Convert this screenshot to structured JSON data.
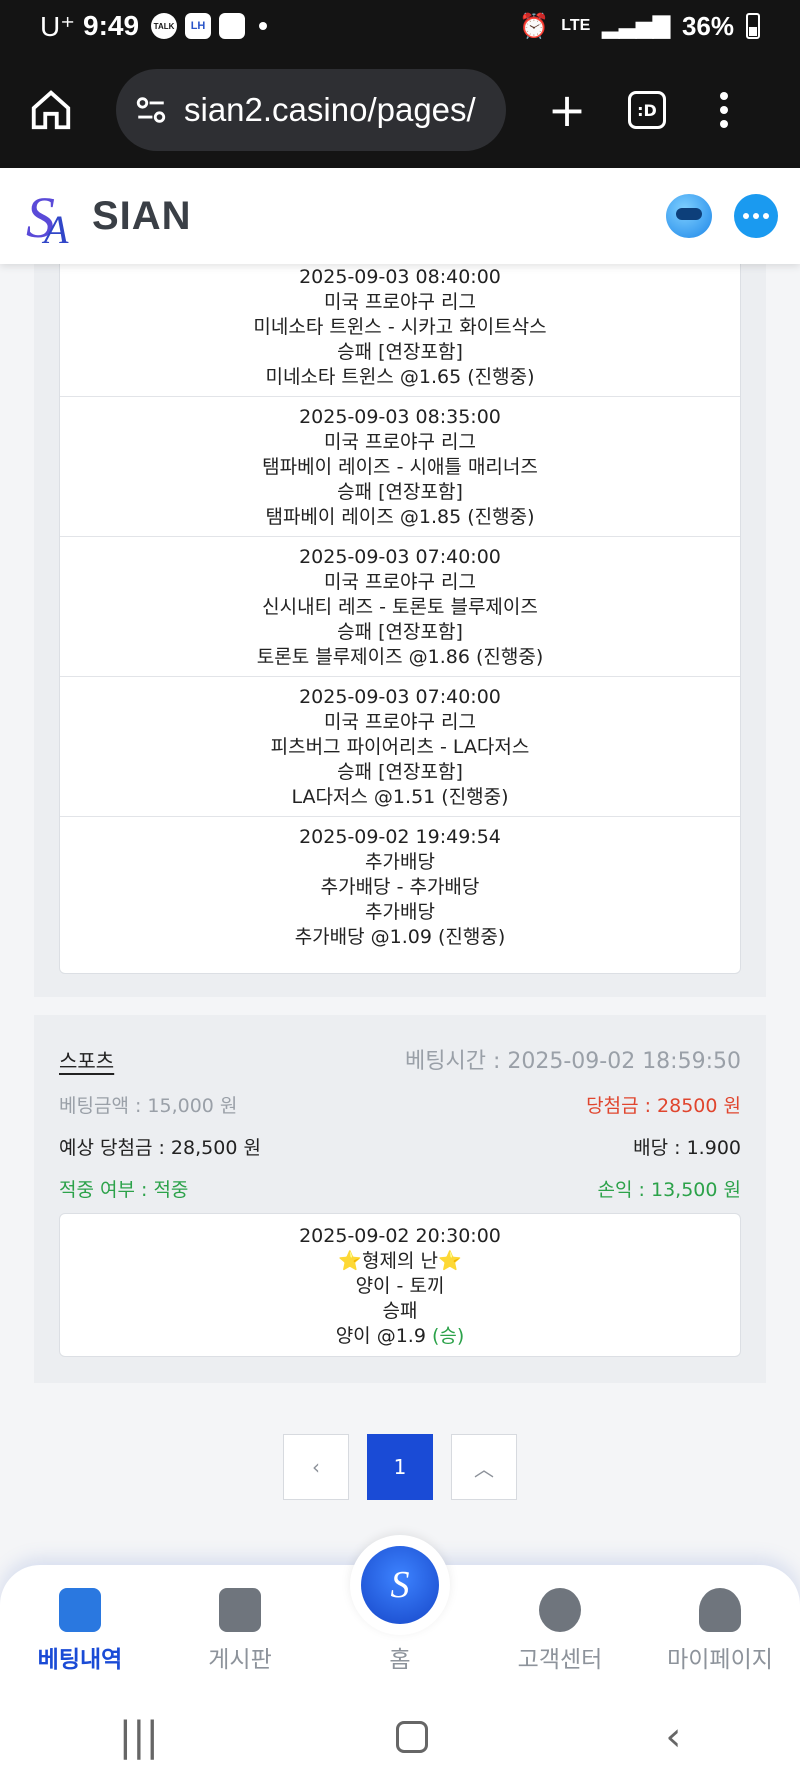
{
  "status": {
    "carrier": "U⁺",
    "time": "9:49",
    "talk": "TALK",
    "lh": "LH",
    "network": "LTE",
    "battery": "36%"
  },
  "browser": {
    "url": "sian2.casino/pages/",
    "tab_count": ":D"
  },
  "site": {
    "brand": "SIAN"
  },
  "legs_top": [
    {
      "time": "2025-09-03 08:40:00",
      "league": "미국 프로야구 리그",
      "match": "미네소타 트윈스 - 시카고 화이트삭스",
      "market": "승패 [연장포함]",
      "pick": "미네소타 트윈스 @1.65 (진행중)"
    },
    {
      "time": "2025-09-03 08:35:00",
      "league": "미국 프로야구 리그",
      "match": "탬파베이 레이즈 - 시애틀 매리너즈",
      "market": "승패 [연장포함]",
      "pick": "탬파베이 레이즈 @1.85 (진행중)"
    },
    {
      "time": "2025-09-03 07:40:00",
      "league": "미국 프로야구 리그",
      "match": "신시내티 레즈 - 토론토 블루제이즈",
      "market": "승패 [연장포함]",
      "pick": "토론토 블루제이즈 @1.86 (진행중)"
    },
    {
      "time": "2025-09-03 07:40:00",
      "league": "미국 프로야구 리그",
      "match": "피츠버그 파이어리츠 - LA다저스",
      "market": "승패 [연장포함]",
      "pick": "LA다저스 @1.51 (진행중)"
    },
    {
      "time": "2025-09-02 19:49:54",
      "league": "추가배당",
      "match": "추가배당 - 추가배당",
      "market": "추가배당",
      "pick": "추가배당 @1.09 (진행중)"
    }
  ],
  "bet2": {
    "category": "스포츠",
    "bet_time": "베팅시간 : 2025-09-02 18:59:50",
    "amount": "베팅금액 : 15,000 원",
    "win": "당첨금 : 28500 원",
    "expected": "예상 당첨금 : 28,500 원",
    "odds": "배당 : 1.900",
    "hit": "적중 여부 : 적중",
    "profit": "손익 : 13,500 원",
    "leg": {
      "time": "2025-09-02 20:30:00",
      "league": "⭐형제의 난⭐",
      "match": "양이 - 토끼",
      "market": "승패",
      "pick": "양이 @1.9 ",
      "result": "(승)"
    }
  },
  "pager": {
    "prev": "‹",
    "page": "1",
    "top": "︿"
  },
  "bottom_nav": {
    "history": "베팅내역",
    "board": "게시판",
    "home": "홈",
    "support": "고객센터",
    "mypage": "마이페이지"
  }
}
